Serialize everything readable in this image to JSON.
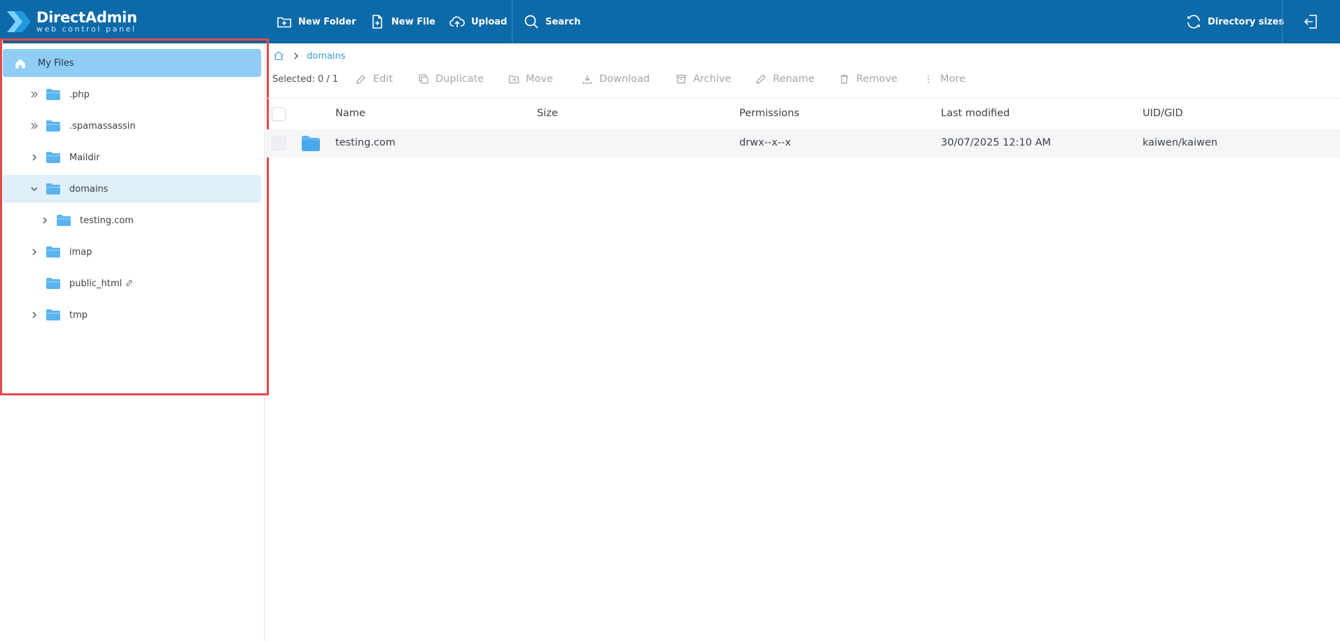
{
  "logo": {
    "title": "DirectAdmin",
    "subtitle": "web control panel"
  },
  "toolbar": {
    "new_folder": "New Folder",
    "new_file": "New File",
    "upload": "Upload",
    "search": "Search",
    "directory_sizes": "Directory sizes"
  },
  "sidebar": {
    "root_label": "My Files",
    "items": [
      {
        "label": ".php",
        "expander": "double-chevron"
      },
      {
        "label": ".spamassassin",
        "expander": "double-chevron"
      },
      {
        "label": "Maildir",
        "expander": "chevron-right"
      },
      {
        "label": "domains",
        "expander": "chevron-down"
      },
      {
        "label": "testing.com",
        "expander": "chevron-right"
      },
      {
        "label": "imap",
        "expander": "chevron-right"
      },
      {
        "label": "public_html",
        "expander": "none",
        "link_icon": "link-icon"
      },
      {
        "label": "tmp",
        "expander": "chevron-right"
      }
    ]
  },
  "breadcrumb": {
    "current": "domains"
  },
  "actions": {
    "selected": "Selected: 0 / 1",
    "edit": "Edit",
    "duplicate": "Duplicate",
    "move": "Move",
    "download": "Download",
    "archive": "Archive",
    "rename": "Rename",
    "remove": "Remove",
    "more": "More"
  },
  "table": {
    "columns": [
      "Name",
      "Size",
      "Permissions",
      "Last modified",
      "UID/GID"
    ],
    "rows": [
      {
        "name": "testing.com",
        "size": "",
        "permissions": "drwx--x--x",
        "modified": "30/07/2025 12:10 AM",
        "uid_gid": "kaiwen/kaiwen"
      }
    ]
  },
  "colors": {
    "topbar": "#0d6aa8",
    "accent": "#3a9ad9",
    "folder": "#5ab4ef",
    "highlight": "#e24a4a"
  }
}
